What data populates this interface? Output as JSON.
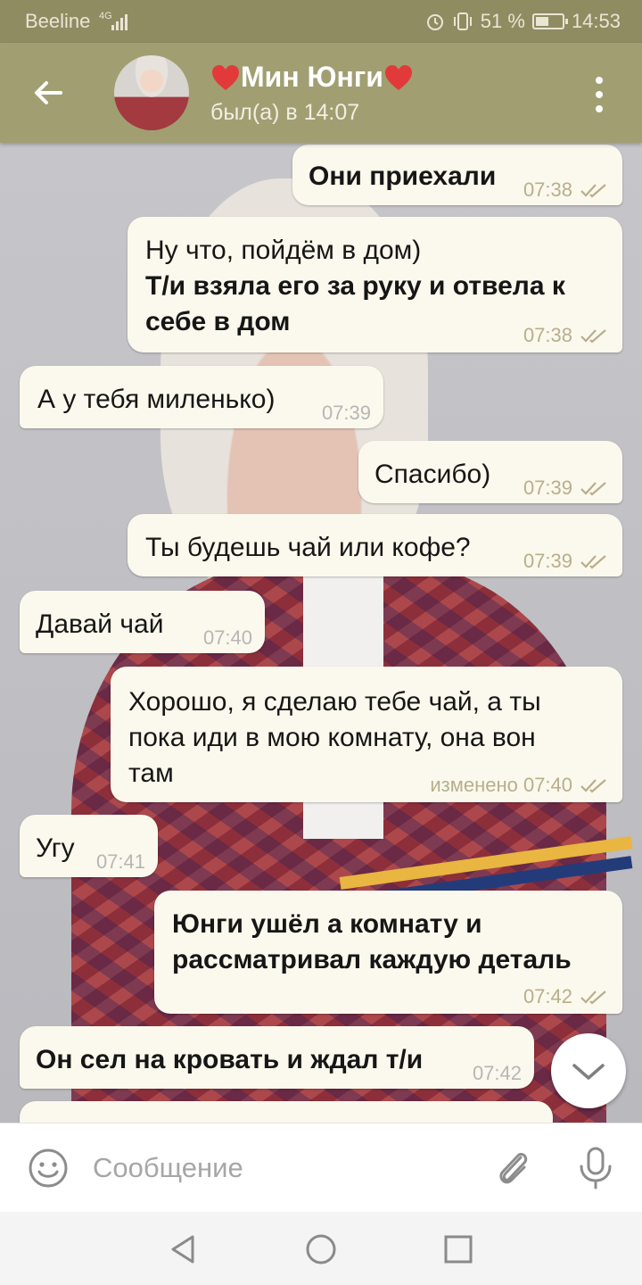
{
  "status_bar": {
    "carrier": "Beeline",
    "network": "4G",
    "battery": "51 %",
    "battery_level": 0.51,
    "time": "14:53"
  },
  "header": {
    "title": "Мин Юнги",
    "status": "был(а) в 14:07"
  },
  "messages": [
    {
      "direction": "out",
      "lines": [
        "Они приехали"
      ],
      "time": "07:38",
      "read": true
    },
    {
      "direction": "out",
      "lines": [
        "Ну что, пойдём в дом)",
        "Т/и взяла его за руку и отвела к",
        "себе в дом"
      ],
      "time": "07:38",
      "read": true
    },
    {
      "direction": "in",
      "lines": [
        "А у тебя миленько)"
      ],
      "time": "07:39"
    },
    {
      "direction": "out",
      "lines": [
        "Спасибо)"
      ],
      "time": "07:39",
      "read": true
    },
    {
      "direction": "out",
      "lines": [
        "Ты будешь чай или кофе?"
      ],
      "time": "07:39",
      "read": true
    },
    {
      "direction": "in",
      "lines": [
        "Давай чай"
      ],
      "time": "07:40"
    },
    {
      "direction": "out",
      "lines": [
        "Хорошо, я сделаю тебе чай, а ты",
        "пока иди в мою комнату, она вон",
        "там"
      ],
      "time": "изменено 07:40",
      "read": true
    },
    {
      "direction": "in",
      "lines": [
        "Угу"
      ],
      "time": "07:41"
    },
    {
      "direction": "out",
      "lines": [
        "Юнги ушёл а комнату и",
        "рассматривал каждую деталь"
      ],
      "time": "07:42",
      "read": true
    },
    {
      "direction": "in",
      "lines": [
        "Он сел на кровать и ждал т/и"
      ],
      "time": "07:42"
    }
  ],
  "composer": {
    "placeholder": "Сообщение"
  },
  "icons": {
    "back": "arrow-left-icon",
    "menu": "more-vertical-icon",
    "emoji": "emoji-smile-icon",
    "attach": "paperclip-icon",
    "mic": "microphone-icon",
    "scroll": "chevron-down-icon",
    "read": "double-check-icon"
  },
  "colors": {
    "header": "#a19e72",
    "status_bar": "#8f8c62",
    "bubble": "#fbf9ed",
    "check": "#b8ae8c"
  }
}
